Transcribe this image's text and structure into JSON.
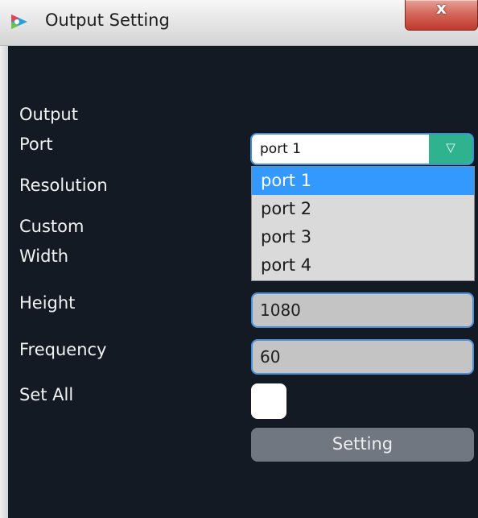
{
  "window": {
    "title": "Output Setting",
    "close_glyph": "x",
    "app_icon": "app-logo-icon"
  },
  "form": {
    "output_label": "Output",
    "port_label": "Port",
    "resolution_label": "Resolution",
    "custom_label": "Custom",
    "width_label": "Width",
    "height_label": "Height",
    "frequency_label": "Frequency",
    "set_all_label": "Set All",
    "port_select": {
      "value": "port 1",
      "arrow_glyph": "▽",
      "options": [
        "port 1",
        "port 2",
        "port 3",
        "port 4"
      ],
      "selected_index": 0
    },
    "height_value": "1080",
    "frequency_value": "60",
    "set_all_checked": false,
    "setting_button": "Setting"
  },
  "colors": {
    "body_bg": "#141a24",
    "select_arrow": "#2fb38f",
    "option_highlight": "#3399ff",
    "field_border": "#4a90d9",
    "button_bg": "#717780"
  }
}
